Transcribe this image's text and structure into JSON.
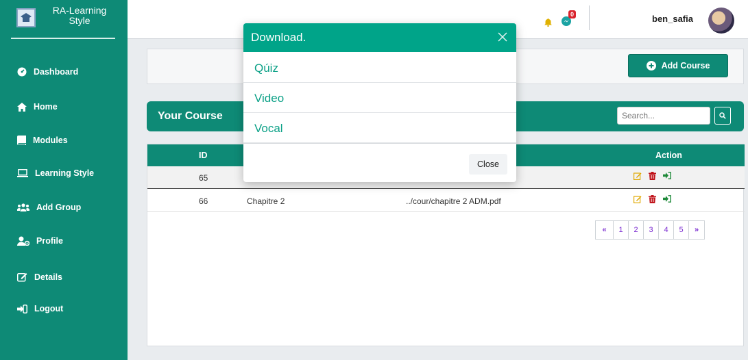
{
  "brand": {
    "line1": "RA-Learning",
    "line2": "Style"
  },
  "sidebar": {
    "items": [
      {
        "label": "Dashboard",
        "icon": "dashboard-icon"
      },
      {
        "label": "Home",
        "icon": "home-icon"
      },
      {
        "label": "Modules",
        "icon": "book-icon"
      },
      {
        "label": "Learning Style",
        "icon": "laptop-icon"
      },
      {
        "label": "Add Group",
        "icon": "users-icon"
      },
      {
        "label": "Profile",
        "icon": "user-cog-icon"
      },
      {
        "label": "Details",
        "icon": "edit-icon"
      },
      {
        "label": "Logout",
        "icon": "sign-out-icon"
      }
    ]
  },
  "topbar": {
    "notification_count": "0",
    "username": "ben_safia"
  },
  "main": {
    "add_course_label": "Add Course",
    "course_title": "Your Course",
    "search_placeholder": "Search...",
    "table": {
      "headers": [
        "ID",
        "Action"
      ],
      "rows": [
        {
          "id": "65",
          "name": "",
          "path": ""
        },
        {
          "id": "66",
          "name": "Chapitre 2",
          "path": "../cour/chapitre 2 ADM.pdf"
        }
      ]
    },
    "pagination": [
      "«",
      "1",
      "2",
      "3",
      "4",
      "5",
      "»"
    ]
  },
  "modal": {
    "title": "Download.",
    "items": [
      "Qúiz",
      "Video",
      "Vocal"
    ],
    "close_label": "Close"
  },
  "colors": {
    "primary": "#0e8a76",
    "modal_header": "#00a489",
    "badge": "#d9232d",
    "edit": "#e0a800",
    "delete": "#c0141b",
    "go": "#1f8a3a",
    "pager_text": "#7a2bd0"
  }
}
